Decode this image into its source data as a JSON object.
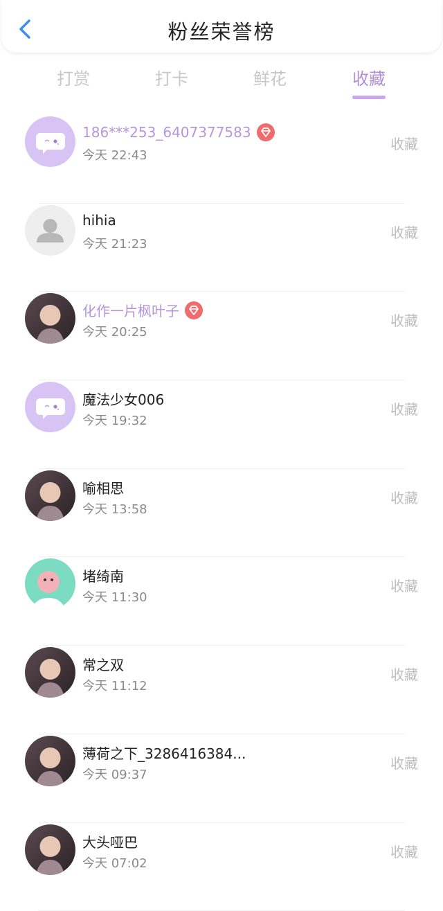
{
  "header": {
    "title": "粉丝荣誉榜"
  },
  "tabs": [
    {
      "label": "打赏",
      "active": false
    },
    {
      "label": "打卡",
      "active": false
    },
    {
      "label": "鲜花",
      "active": false
    },
    {
      "label": "收藏",
      "active": true
    }
  ],
  "colors": {
    "accent": "#b894dc",
    "underline": "#c9a6ee",
    "vip_badge": "#f06b6b",
    "back_icon": "#3a8ef0"
  },
  "fans": [
    {
      "name": "186***253_6407377583",
      "vip": true,
      "time": "今天 22:43",
      "action": "收藏",
      "avatar": "chat-bubble-avatar"
    },
    {
      "name": "hihia",
      "vip": false,
      "time": "今天 21:23",
      "action": "收藏",
      "avatar": "default-user-avatar"
    },
    {
      "name": "化作一片枫叶子",
      "vip": true,
      "time": "今天 20:25",
      "action": "收藏",
      "avatar": "photo-avatar"
    },
    {
      "name": "魔法少女006",
      "vip": false,
      "time": "今天 19:32",
      "action": "收藏",
      "avatar": "chat-bubble-avatar"
    },
    {
      "name": "喻相思",
      "vip": false,
      "time": "今天 13:58",
      "action": "收藏",
      "avatar": "photo-avatar"
    },
    {
      "name": "堵绮南",
      "vip": false,
      "time": "今天 11:30",
      "action": "收藏",
      "avatar": "cartoon-avatar"
    },
    {
      "name": "常之双",
      "vip": false,
      "time": "今天 11:12",
      "action": "收藏",
      "avatar": "photo-avatar"
    },
    {
      "name": "薄荷之下_3286416384...",
      "vip": false,
      "time": "今天 09:37",
      "action": "收藏",
      "avatar": "photo-avatar"
    },
    {
      "name": "大头哑巴",
      "vip": false,
      "time": "今天 07:02",
      "action": "收藏",
      "avatar": "photo-avatar"
    }
  ]
}
